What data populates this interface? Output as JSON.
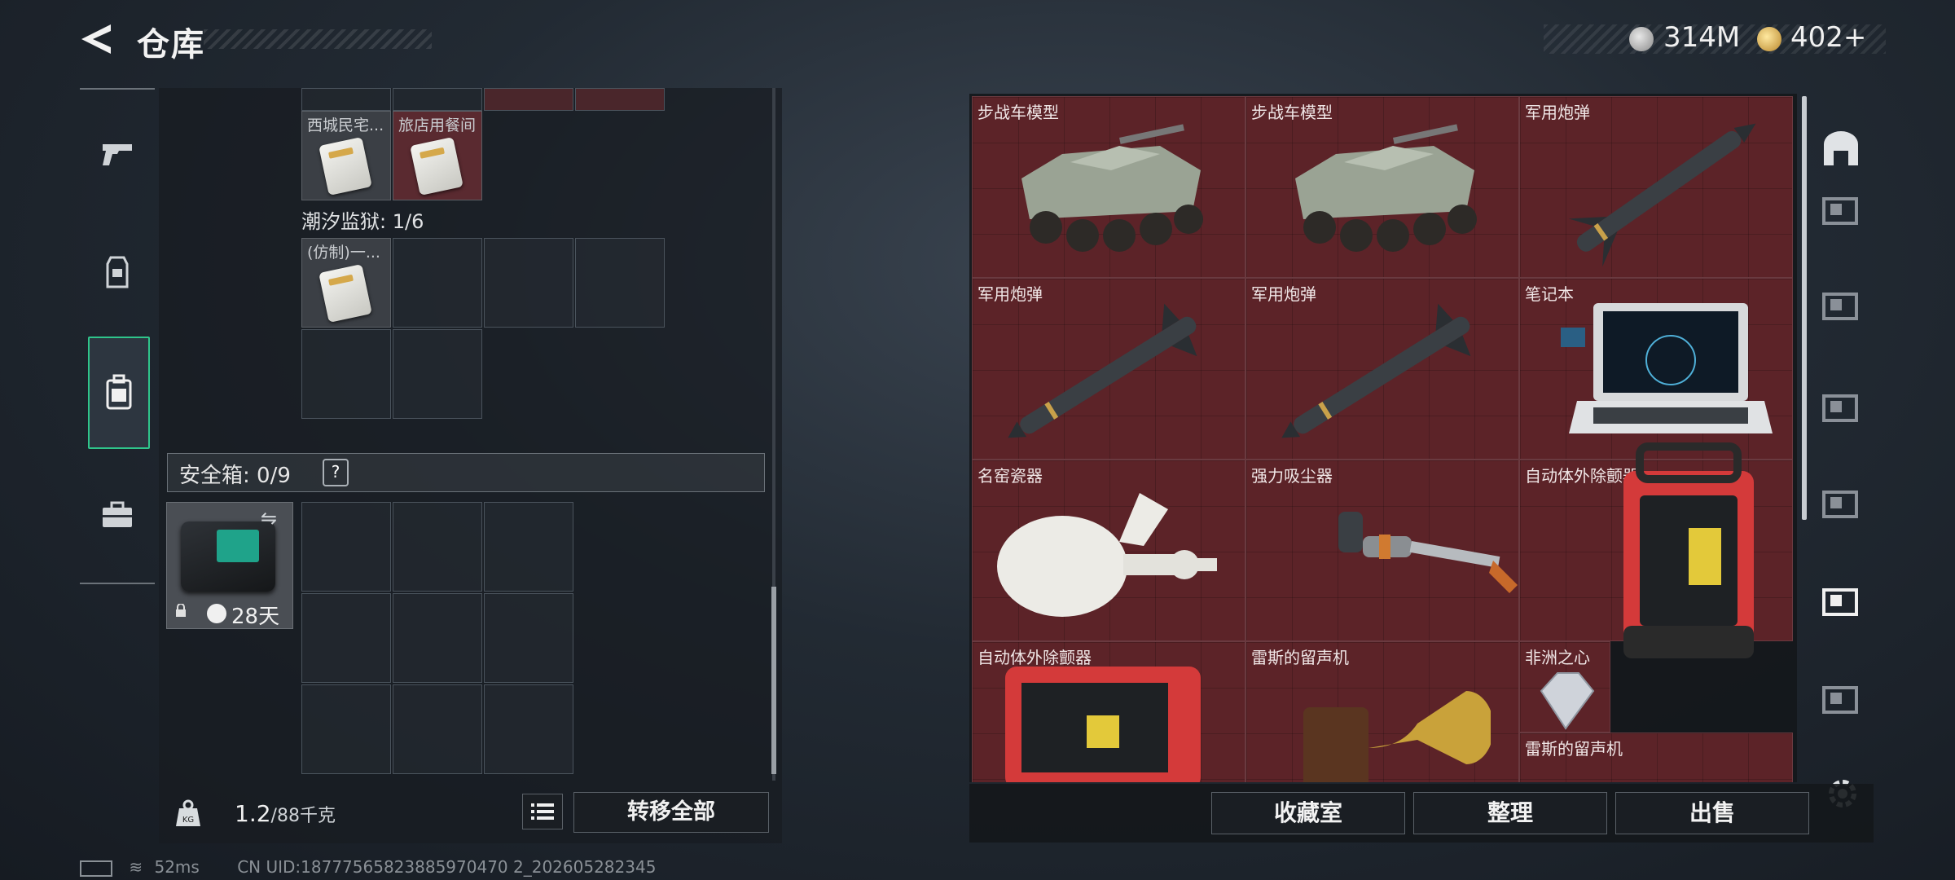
{
  "header": {
    "title": "仓库",
    "currency_silver": "314M",
    "currency_gold": "402+"
  },
  "backpack": {
    "items": [
      {
        "label": "西城民宅..."
      },
      {
        "label": "旅店用餐间"
      },
      {
        "label": "(仿制)一..."
      }
    ],
    "map_label": "潮汐监狱: 1/6",
    "safe_label": "安全箱: 0/9",
    "help": "?",
    "safe_days": "28天"
  },
  "footer_left": {
    "weight_value": "1.2",
    "weight_unit": "/88千克",
    "transfer_all": "转移全部"
  },
  "storage": {
    "items": [
      {
        "label": "步战车模型",
        "kind": "vehicle"
      },
      {
        "label": "步战车模型",
        "kind": "vehicle"
      },
      {
        "label": "军用炮弹",
        "kind": "missile"
      },
      {
        "label": "军用炮弹",
        "kind": "missile"
      },
      {
        "label": "军用炮弹",
        "kind": "missile"
      },
      {
        "label": "笔记本",
        "kind": "laptop"
      },
      {
        "label": "名窑瓷器",
        "kind": "vase"
      },
      {
        "label": "强力吸尘器",
        "kind": "vacuum"
      },
      {
        "label": "自动体外除颤器",
        "kind": "aed"
      },
      {
        "label": "自动体外除颤器",
        "kind": "aed"
      },
      {
        "label": "雷斯的留声机",
        "kind": "gramophone"
      },
      {
        "label": "非洲之心",
        "kind": "diamond"
      },
      {
        "label": "雷斯的留声机",
        "kind": "gramophone"
      }
    ]
  },
  "footer_right": {
    "collection": "收藏室",
    "sort": "整理",
    "sell": "出售"
  },
  "status": {
    "ping": "52ms",
    "uid": "CN UID:18777565823885970470 2_202605282345"
  },
  "colors": {
    "accent": "#2fc58b",
    "item_bg": "#5c2328"
  }
}
